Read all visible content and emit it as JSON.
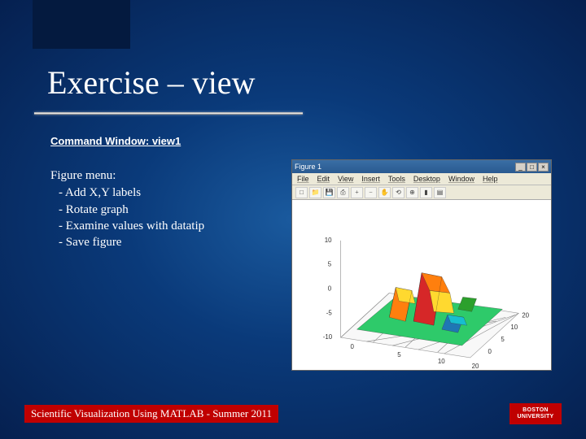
{
  "slide": {
    "title": "Exercise – view",
    "command_window": "Command Window: view1",
    "figure_menu": {
      "heading": "Figure menu:",
      "items": [
        "- Add X,Y labels",
        "- Rotate graph",
        "- Examine values with datatip",
        "- Save figure"
      ]
    },
    "footer": "Scientific Visualization Using MATLAB - Summer 2011",
    "logo_text": "BOSTON\nUNIVERSITY"
  },
  "matlab_window": {
    "title": "Figure 1",
    "window_buttons": [
      "_",
      "□",
      "×"
    ],
    "menu": [
      "File",
      "Edit",
      "View",
      "Insert",
      "Tools",
      "Desktop",
      "Window",
      "Help"
    ],
    "toolbar_icons": [
      "new-icon",
      "open-icon",
      "save-icon",
      "print-icon",
      "zoom-in-icon",
      "zoom-out-icon",
      "pan-icon",
      "rotate-icon",
      "datatip-icon",
      "colorbar-icon",
      "legend-icon"
    ]
  },
  "chart_data": {
    "type": "surface3d",
    "description": "MATLAB peaks-style 3D surface on a mesh grid",
    "x_range": [
      -20,
      20
    ],
    "y_range": [
      -20,
      20
    ],
    "z_range": [
      -10,
      10
    ],
    "x_ticks": [
      0,
      5,
      10,
      20
    ],
    "y_ticks": [
      0,
      5,
      10,
      20
    ],
    "z_ticks": [
      -10,
      -5,
      0,
      5,
      10
    ],
    "colormap": "jet",
    "grid": true,
    "title": "",
    "xlabel": "",
    "ylabel": "",
    "zlabel": ""
  }
}
